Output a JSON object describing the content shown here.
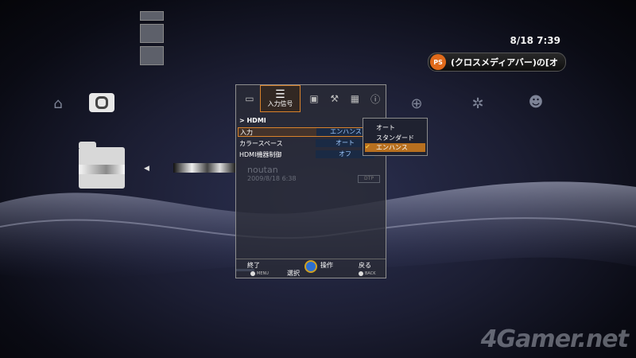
{
  "status": {
    "clock": "8/18 7:39",
    "notification": "(クロスメディアバー)の[オ"
  },
  "xmb": {
    "icons": [
      "users-icon",
      "photo-icon",
      "music-icon",
      "video-icon",
      "game-icon",
      "network-icon",
      "playstation-network-icon",
      "friends-icon"
    ]
  },
  "ghost_item": {
    "title": "noutan",
    "date": "2009/8/18  6:38"
  },
  "panel": {
    "tabs": [
      {
        "name": "picture-tab",
        "icon": "picture-icon"
      },
      {
        "name": "input-signal-tab",
        "label": "入力信号",
        "icon": "input-signal-icon"
      },
      {
        "name": "screen-tab",
        "icon": "screen-icon"
      },
      {
        "name": "setup-tab",
        "icon": "wrench-icon"
      },
      {
        "name": "function-tab",
        "icon": "keyboard-icon"
      },
      {
        "name": "info-tab",
        "icon": "info-icon"
      }
    ],
    "section": "> HDMI",
    "rows": [
      {
        "label": "入力",
        "value": "エンハンス"
      },
      {
        "label": "カラースペース",
        "value": "オート"
      },
      {
        "label": "HDMI機器制御",
        "value": "オフ"
      }
    ],
    "footer": {
      "exit": "終了",
      "exit_btn": "MENU",
      "select": "選択",
      "operate": "操作",
      "back": "戻る",
      "back_btn": "BACK"
    }
  },
  "dropdown": {
    "options": [
      "オート",
      "スタンダード",
      "エンハンス"
    ],
    "selected_index": 2
  },
  "watermark": "4Gamer.net",
  "colors": {
    "accent": "#d9822b",
    "value_bg": "#1a2a44",
    "value_text": "#9ec9ff",
    "notify_icon": "#e06a1b"
  }
}
